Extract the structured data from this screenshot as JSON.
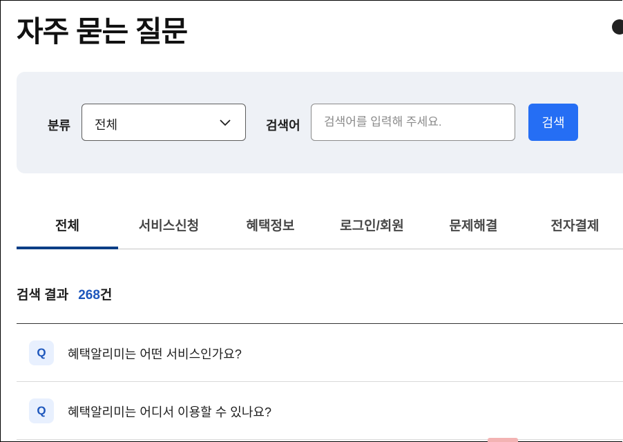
{
  "page": {
    "title": "자주 묻는 질문"
  },
  "search": {
    "category_label": "분류",
    "category_value": "전체",
    "keyword_label": "검색어",
    "keyword_placeholder": "검색어를 입력해 주세요.",
    "button_label": "검색"
  },
  "tabs": [
    {
      "label": "전체",
      "active": true
    },
    {
      "label": "서비스신청",
      "active": false
    },
    {
      "label": "혜택정보",
      "active": false
    },
    {
      "label": "로그인/회원",
      "active": false
    },
    {
      "label": "문제해결",
      "active": false
    },
    {
      "label": "전자결제",
      "active": false
    }
  ],
  "results": {
    "label": "검색 결과",
    "count": "268",
    "unit": "건"
  },
  "faq": [
    {
      "badge": "Q",
      "question": "혜택알리미는 어떤 서비스인가요?"
    },
    {
      "badge": "Q",
      "question": "혜택알리미는 어디서 이용할 수 있나요?"
    }
  ],
  "colors": {
    "accent": "#256ef4",
    "tab_indicator": "#0b3e86",
    "count": "#1d56bc",
    "panel_bg": "#eef1f6"
  }
}
